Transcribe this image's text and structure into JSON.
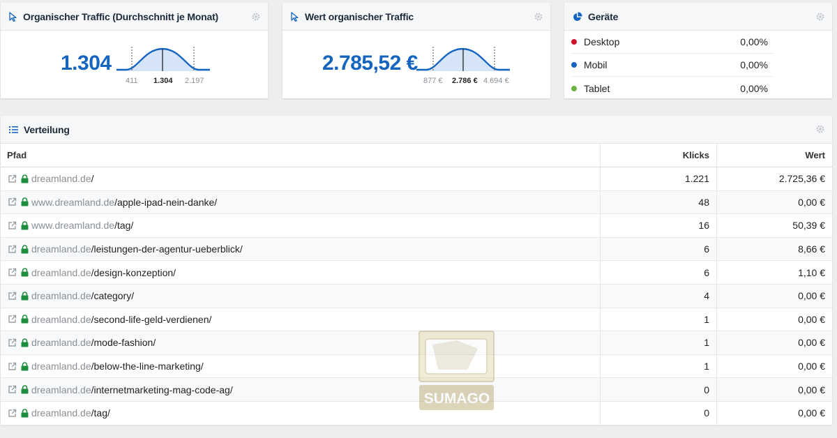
{
  "traffic_card": {
    "title": "Organischer Traffic (Durchschnitt je Monat)",
    "icon": "cursor-icon",
    "value": "1.304",
    "low": "411",
    "mid": "1.304",
    "high": "2.197"
  },
  "value_card": {
    "title": "Wert organischer Traffic",
    "icon": "cursor-icon",
    "value": "2.785,52 €",
    "low": "877 €",
    "mid": "2.786 €",
    "high": "4.694 €"
  },
  "devices_card": {
    "title": "Geräte",
    "icon": "pie-chart-icon",
    "items": [
      {
        "label": "Desktop",
        "value": "0,00%",
        "color": "#d0102b"
      },
      {
        "label": "Mobil",
        "value": "0,00%",
        "color": "#1565c0"
      },
      {
        "label": "Tablet",
        "value": "0,00%",
        "color": "#6cb33f"
      }
    ]
  },
  "distribution": {
    "title": "Verteilung",
    "icon": "list-icon",
    "columns": {
      "path": "Pfad",
      "clicks": "Klicks",
      "value": "Wert"
    },
    "rows": [
      {
        "domain": "dreamland.de",
        "path": "/",
        "clicks": "1.221",
        "value": "2.725,36 €"
      },
      {
        "domain": "www.dreamland.de",
        "path": "/apple-ipad-nein-danke/",
        "clicks": "48",
        "value": "0,00 €"
      },
      {
        "domain": "www.dreamland.de",
        "path": "/tag/",
        "clicks": "16",
        "value": "50,39 €"
      },
      {
        "domain": "dreamland.de",
        "path": "/leistungen-der-agentur-ueberblick/",
        "clicks": "6",
        "value": "8,66 €"
      },
      {
        "domain": "dreamland.de",
        "path": "/design-konzeption/",
        "clicks": "6",
        "value": "1,10 €"
      },
      {
        "domain": "dreamland.de",
        "path": "/category/",
        "clicks": "4",
        "value": "0,00 €"
      },
      {
        "domain": "dreamland.de",
        "path": "/second-life-geld-verdienen/",
        "clicks": "1",
        "value": "0,00 €"
      },
      {
        "domain": "dreamland.de",
        "path": "/mode-fashion/",
        "clicks": "1",
        "value": "0,00 €"
      },
      {
        "domain": "dreamland.de",
        "path": "/below-the-line-marketing/",
        "clicks": "1",
        "value": "0,00 €"
      },
      {
        "domain": "dreamland.de",
        "path": "/internetmarketing-mag-code-ag/",
        "clicks": "0",
        "value": "0,00 €"
      },
      {
        "domain": "dreamland.de",
        "path": "/tag/",
        "clicks": "0",
        "value": "0,00 €"
      }
    ]
  },
  "watermark": {
    "text": "SUMAGO"
  },
  "colors": {
    "accent": "#1565c0",
    "lock": "#1e8e3e"
  }
}
